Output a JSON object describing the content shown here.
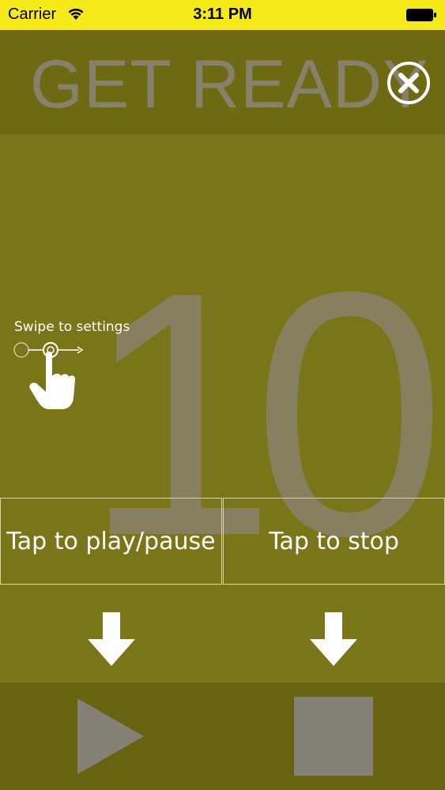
{
  "status_bar": {
    "carrier": "Carrier",
    "time": "3:11 PM"
  },
  "header": {
    "title": "GET READY"
  },
  "counter": {
    "value": "10"
  },
  "swipe_hint": {
    "label": "Swipe to settings"
  },
  "tap_areas": {
    "play_pause_label": "Tap to play/pause",
    "stop_label": "Tap to stop"
  },
  "controls": {
    "play_icon": "play-icon",
    "stop_icon": "stop-icon"
  },
  "colors": {
    "status_bar": "#f6ea1a",
    "background": "#7a7518",
    "header_bg": "#6e6a13",
    "controls_bg": "#686311",
    "muted_gray": "#868060"
  }
}
